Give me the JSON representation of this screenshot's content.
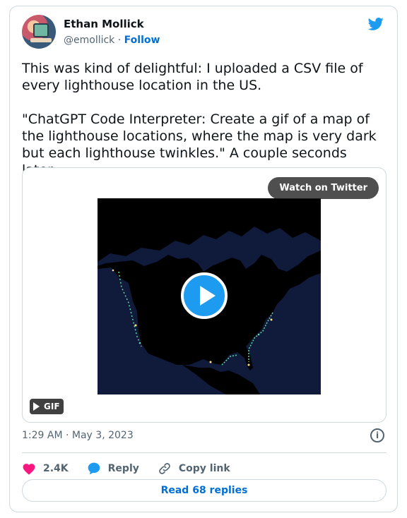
{
  "author": {
    "name": "Ethan Mollick",
    "handle": "@emollick",
    "separator": "·",
    "follow_label": "Follow"
  },
  "tweet": {
    "paragraph_1": "This was kind of delightful: I uploaded a CSV file of every lighthouse location in the US.",
    "paragraph_2": "\"ChatGPT Code Interpreter: Create a gif of a map of the lighthouse locations, where the map is very dark but each lighthouse twinkles.\" A couple seconds later..."
  },
  "media": {
    "watch_label": "Watch on Twitter",
    "badge_label": "GIF"
  },
  "meta": {
    "timestamp": "1:29 AM · May 3, 2023"
  },
  "actions": {
    "likes": "2.4K",
    "reply_label": "Reply",
    "copy_label": "Copy link"
  },
  "footer": {
    "read_replies_label": "Read 68 replies"
  },
  "colors": {
    "accent": "#1d9bf0",
    "link": "#006fd6",
    "like": "#f91880",
    "map_ocean": "#101a3a",
    "map_land": "#000000",
    "lighthouse": "#5fd7a0"
  },
  "icons": [
    "twitter-bird-icon",
    "play-icon",
    "gif-play-icon",
    "info-icon",
    "heart-icon",
    "reply-bubble-icon",
    "link-icon"
  ]
}
